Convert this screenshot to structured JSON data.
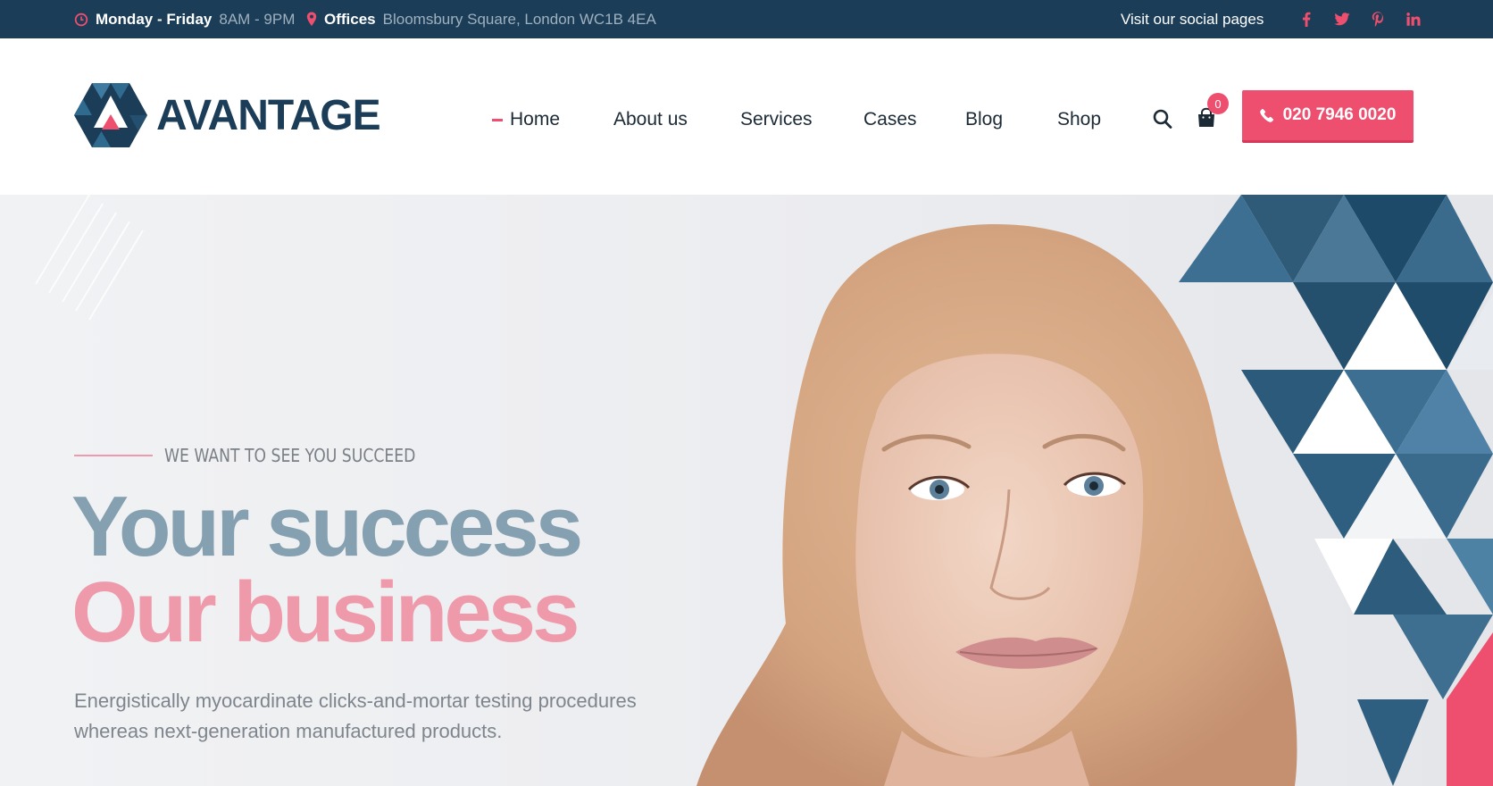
{
  "topbar": {
    "hours_label": "Monday - Friday",
    "hours_value": "8AM - 9PM",
    "offices_label": "Offices",
    "offices_value": "Bloomsbury Square, London WC1B 4EA",
    "social_label": "Visit our social pages",
    "social_icons": [
      "facebook-icon",
      "twitter-icon",
      "pinterest-icon",
      "linkedin-icon"
    ]
  },
  "header": {
    "logo_text": "AVANTAGE",
    "nav": [
      "Home",
      "About us",
      "Services",
      "Cases",
      "Blog",
      "Shop"
    ],
    "active_nav": "Home",
    "cart_count": "0",
    "phone": "020 7946 0020"
  },
  "hero": {
    "eyebrow": "WE WANT TO SEE YOU SUCCEED",
    "title_line1": "Your success",
    "title_line2": "Our business",
    "description": "Energistically myocardinate clicks-and-mortar testing procedures whereas next-generation manufactured products."
  },
  "colors": {
    "navy": "#1b3d57",
    "accent": "#ee4f6e",
    "title_blue": "#85a0b0",
    "title_pink": "#ee9aab"
  }
}
